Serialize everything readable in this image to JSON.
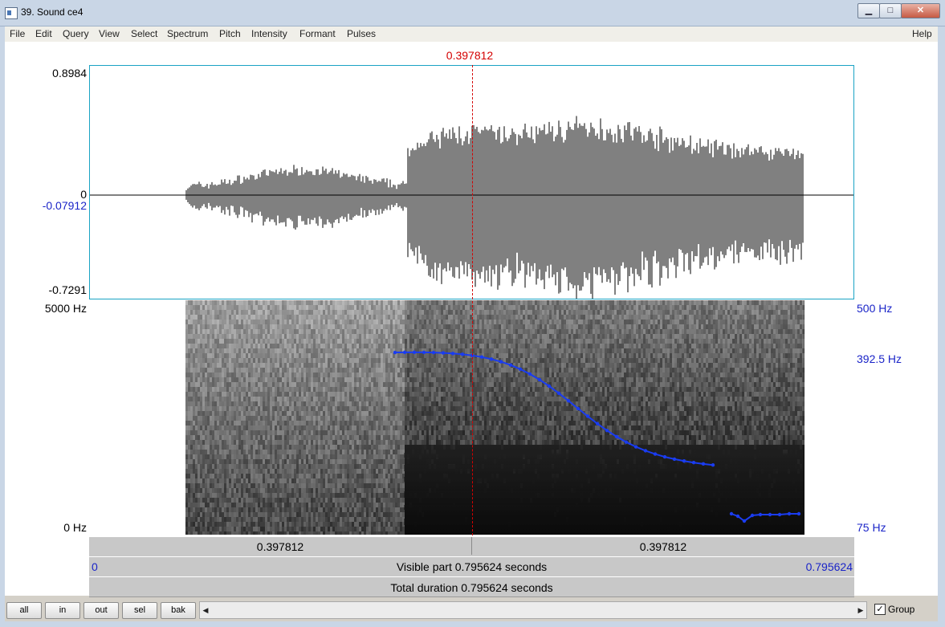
{
  "window": {
    "title": "39. Sound ce4",
    "minimize_glyph": "▁",
    "maximize_glyph": "□",
    "close_glyph": "✕"
  },
  "menu": [
    "File",
    "Edit",
    "Query",
    "View",
    "Select",
    "Spectrum",
    "Pitch",
    "Intensity",
    "Formant",
    "Pulses"
  ],
  "help_label": "Help",
  "cursor_time": "0.397812",
  "waveform": {
    "ymax": "0.8984",
    "zero": "0",
    "cursor_value": "-0.07912",
    "ymin": "-0.7291"
  },
  "spectrogram": {
    "fmax": "5000 Hz",
    "fmin": "0 Hz"
  },
  "pitch": {
    "max": "500 Hz",
    "cursor": "392.5 Hz",
    "min": "75 Hz",
    "color": "#1a3cf0"
  },
  "time_bar": {
    "left": "0.397812",
    "right": "0.397812"
  },
  "visible_bar": {
    "start": "0",
    "label": "Visible part 0.795624 seconds",
    "end": "0.795624"
  },
  "total_bar": {
    "label": "Total duration 0.795624 seconds"
  },
  "nav_buttons": [
    "all",
    "in",
    "out",
    "sel",
    "bak"
  ],
  "scroll": {
    "left_arrow": "◀",
    "right_arrow": "▶"
  },
  "group": {
    "label": "Group",
    "checked": "✓"
  },
  "colors": {
    "cursor": "#d40000",
    "accent": "#1a24c8"
  }
}
